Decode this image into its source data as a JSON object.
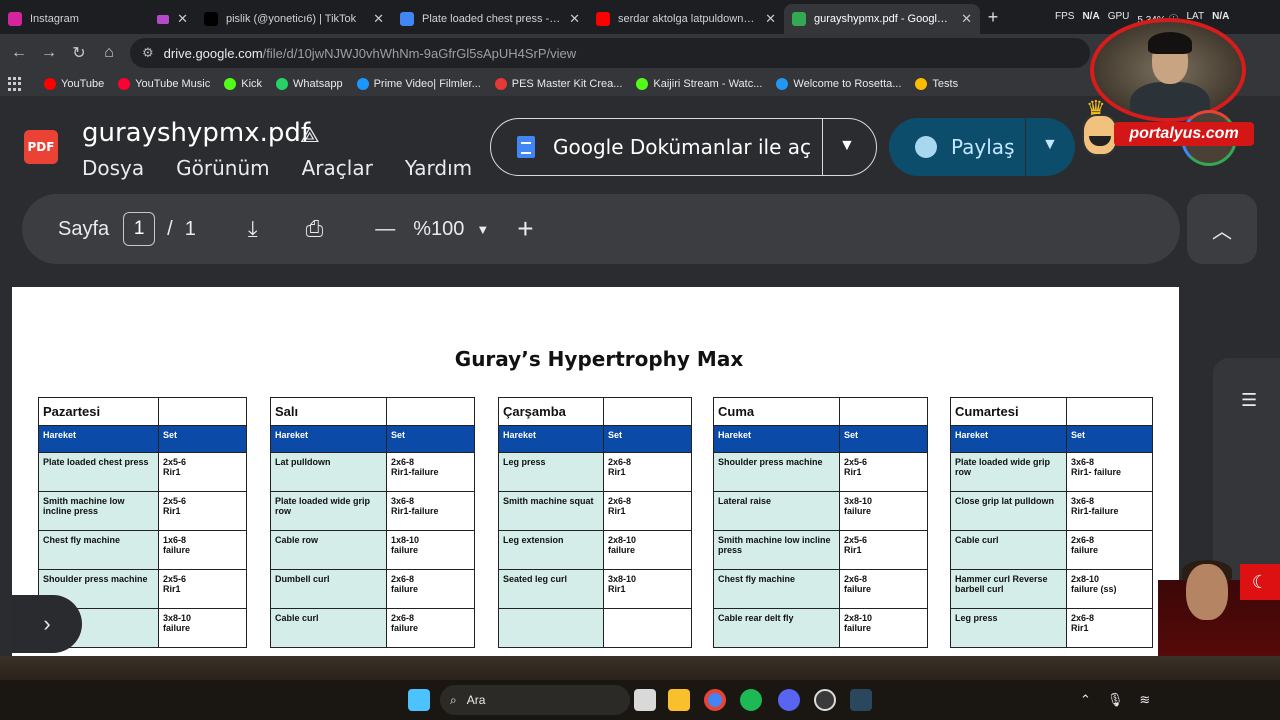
{
  "browser": {
    "tabs": [
      {
        "title": "Instagram",
        "color": "#d6249f",
        "active": false,
        "media": true
      },
      {
        "title": "pislik (@yoneticı6) | TikTok",
        "color": "#000000",
        "active": false,
        "media": false
      },
      {
        "title": "Plate loaded chest press - Goog",
        "color": "#4285f4",
        "active": false,
        "media": false
      },
      {
        "title": "serdar aktolga latpuldown - You",
        "color": "#ff0000",
        "active": false,
        "media": false
      },
      {
        "title": "gurayshypmx.pdf - Google Driv",
        "color": "#34a853",
        "active": true,
        "media": false
      }
    ],
    "tab_close": "✕",
    "new_tab": "+",
    "stats": {
      "fps_label": "FPS",
      "fps_value": "N/A",
      "gpu_label": "GPU",
      "extra": "5 34% ⓘ",
      "lang": "LAT",
      "lang_value": "N/A"
    },
    "url": {
      "domain": "drive.google.com",
      "path": "/file/d/10jwNJWJ0vhWhNm-9aGfrGl5sApUH4SrP/view"
    },
    "bookmarks": [
      {
        "label": "YouTube",
        "color": "#ff0000"
      },
      {
        "label": "YouTube Music",
        "color": "#ff0033"
      },
      {
        "label": "Kick",
        "color": "#53fc18"
      },
      {
        "label": "Whatsapp",
        "color": "#25d366"
      },
      {
        "label": "Prime Video| Filmler...",
        "color": "#1a98ff"
      },
      {
        "label": "PES Master Kit Crea...",
        "color": "#e53935"
      },
      {
        "label": "Kaijiri Stream - Watc...",
        "color": "#53fc18"
      },
      {
        "label": "Welcome to Rosetta...",
        "color": "#2196f3"
      },
      {
        "label": "Tests",
        "color": "#fbbc04"
      }
    ]
  },
  "drive": {
    "file_icon": "PDF",
    "filename": "gurayshypmx.pdf",
    "menu": [
      "Dosya",
      "Görünüm",
      "Araçlar",
      "Yardım"
    ],
    "open_with": "Google Dokümanlar ile aç",
    "share": "Paylaş",
    "page_label": "Sayfa",
    "page_current": "1",
    "page_sep": "/",
    "page_total": "1",
    "zoom": "%100",
    "zoom_minus": "—",
    "zoom_plus": "+"
  },
  "pdf": {
    "title": "Guray’s Hypertrophy Max",
    "col_move": "Hareket",
    "col_set": "Set",
    "days": [
      {
        "name": "Pazartesi",
        "rows": [
          {
            "ex": "Plate loaded chest press",
            "set": [
              "2x5-6",
              "Rir1"
            ]
          },
          {
            "ex": "Smith machine low incline press",
            "set": [
              "2x5-6",
              "Rir1"
            ]
          },
          {
            "ex": "Chest fly machine",
            "set": [
              "1x6-8",
              "failure"
            ]
          },
          {
            "ex": "Shoulder press machine",
            "set": [
              "2x5-6",
              "Rir1"
            ]
          },
          {
            "ex": "…l raise",
            "set": [
              "3x8-10",
              "failure"
            ]
          }
        ]
      },
      {
        "name": "Salı",
        "rows": [
          {
            "ex": "Lat pulldown",
            "set": [
              "2x6-8",
              "Rir1-failure"
            ]
          },
          {
            "ex": "Plate loaded wide grip row",
            "set": [
              "3x6-8",
              "Rir1-failure"
            ]
          },
          {
            "ex": "Cable row",
            "set": [
              "1x8-10",
              "failure"
            ]
          },
          {
            "ex": "Dumbell curl",
            "set": [
              "2x6-8",
              "failure"
            ]
          },
          {
            "ex": "Cable curl",
            "set": [
              "2x6-8",
              "failure"
            ]
          }
        ]
      },
      {
        "name": "Çarşamba",
        "rows": [
          {
            "ex": "Leg press",
            "set": [
              "2x6-8",
              "Rir1"
            ]
          },
          {
            "ex": "Smith machine squat",
            "set": [
              "2x6-8",
              "Rir1"
            ]
          },
          {
            "ex": "Leg extension",
            "set": [
              "2x8-10",
              "failure"
            ]
          },
          {
            "ex": "Seated leg curl",
            "set": [
              "3x8-10",
              "Rir1"
            ]
          },
          {
            "ex": "",
            "set": [
              "",
              ""
            ]
          }
        ]
      },
      {
        "name": "Cuma",
        "rows": [
          {
            "ex": "Shoulder press machine",
            "set": [
              "2x5-6",
              "Rir1"
            ]
          },
          {
            "ex": "Lateral raise",
            "set": [
              "3x8-10",
              "failure"
            ]
          },
          {
            "ex": "Smith machine low incline press",
            "set": [
              "2x5-6",
              "Rir1"
            ]
          },
          {
            "ex": "Chest fly machine",
            "set": [
              "2x6-8",
              "failure"
            ]
          },
          {
            "ex": "Cable rear delt fly",
            "set": [
              "2x8-10",
              "failure"
            ]
          }
        ]
      },
      {
        "name": "Cumartesi",
        "rows": [
          {
            "ex": "Plate loaded wide grip row",
            "set": [
              "3x6-8",
              "Rir1- failure"
            ]
          },
          {
            "ex": "Close grip lat pulldown",
            "set": [
              "3x6-8",
              "Rir1-failure"
            ]
          },
          {
            "ex": "Cable curl",
            "set": [
              "2x6-8",
              "failure"
            ]
          },
          {
            "ex": "Hammer curl Reverse  barbell curl",
            "set": [
              "2x8-10",
              "failure (ss)"
            ]
          },
          {
            "ex": "Leg press",
            "set": [
              "2x6-8",
              "Rir1"
            ]
          }
        ]
      }
    ]
  },
  "overlay": {
    "brand": "portalyus.com"
  },
  "taskbar": {
    "search": "Ara"
  }
}
